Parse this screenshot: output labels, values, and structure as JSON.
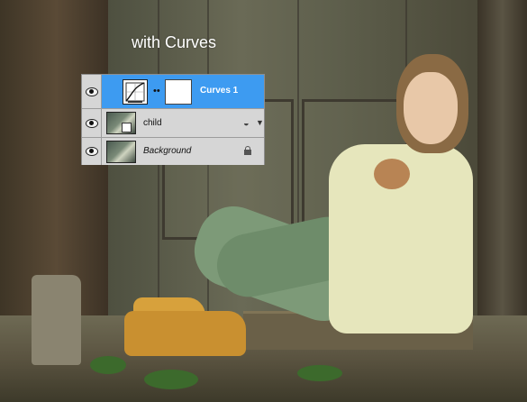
{
  "caption": "with Curves",
  "layers_panel": {
    "layers": [
      {
        "name": "Curves 1",
        "type": "adjustment",
        "selected": true,
        "visible": true,
        "icons": [
          "eye-icon",
          "curves-icon",
          "link-icon",
          "layer-mask-thumbnail"
        ]
      },
      {
        "name": "child",
        "type": "smart-object",
        "selected": false,
        "visible": true,
        "icons": [
          "eye-icon",
          "smart-object-icon",
          "fx-icon",
          "expand-arrow-icon"
        ]
      },
      {
        "name": "Background",
        "type": "background",
        "selected": false,
        "visible": true,
        "icons": [
          "eye-icon",
          "lock-icon"
        ]
      }
    ]
  },
  "colors": {
    "selected_layer": "#3d9bf1",
    "panel_bg": "#d6d6d6"
  }
}
